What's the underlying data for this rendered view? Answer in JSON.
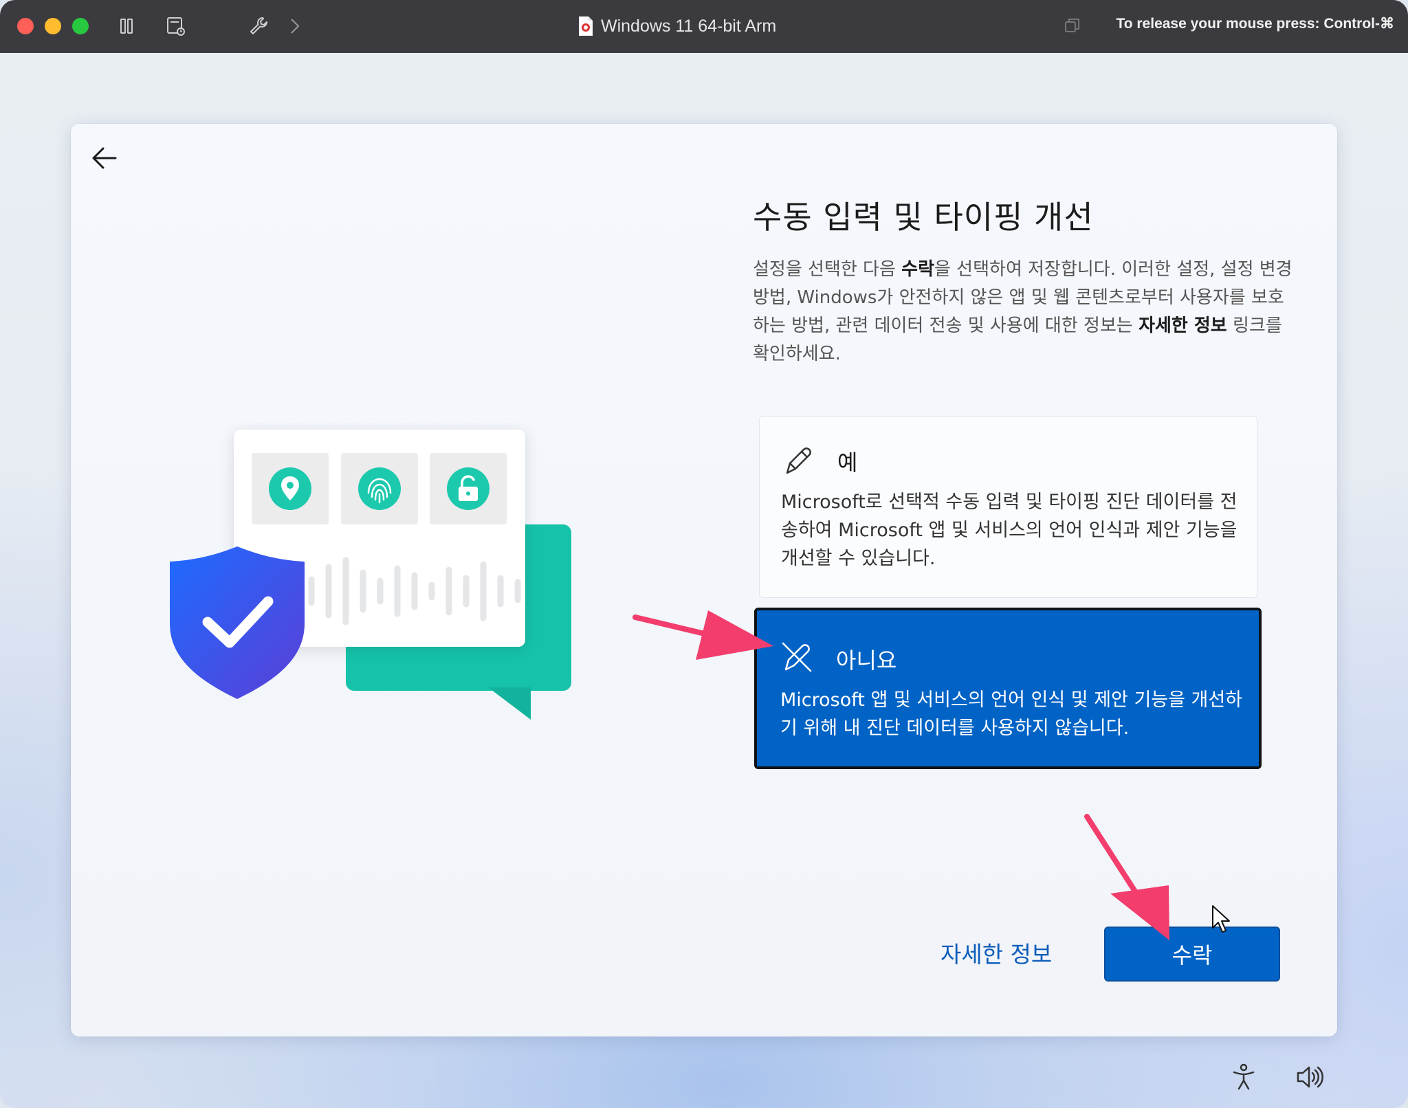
{
  "window": {
    "title": "Windows 11 64-bit Arm",
    "release_hint": "To release your mouse press: Control-⌘"
  },
  "toolbar_icons": [
    "sidebar-toggle-icon",
    "snapshot-icon",
    "wrench-icon",
    "chevron-right-icon",
    "window-copy-icon"
  ],
  "oobe": {
    "title": "수동 입력 및 타이핑 개선",
    "description": {
      "part1": "설정을 선택한 다음 ",
      "bold1": "수락",
      "part2": "을 선택하여 저장합니다. 이러한 설정, 설정 변경 방법, Windows가 안전하지 않은 앱 및 웹 콘텐츠로부터 사용자를 보호하는 방법, 관련 데이터 전송 및 사용에 대한 정보는 ",
      "bold2": "자세한 정보",
      "part3": " 링크를 확인하세요."
    },
    "options": [
      {
        "label": "예",
        "description": "Microsoft로 선택적 수동 입력 및 타이핑 진단 데이터를 전송하여 Microsoft 앱 및 서비스의 언어 인식과 제안 기능을 개선할 수 있습니다.",
        "icon": "pen-icon",
        "selected": false
      },
      {
        "label": "아니요",
        "description": "Microsoft 앱 및 서비스의 언어 인식 및 제안 기능을 개선하기 위해 내 진단 데이터를 사용하지 않습니다.",
        "icon": "pen-off-icon",
        "selected": true
      }
    ],
    "learn_more": "자세한 정보",
    "accept": "수락"
  },
  "colors": {
    "accent": "#0063c5",
    "annotation_arrow": "#f23d6d",
    "illustration_teal": "#1fc9b0",
    "shield_blue": "#2a5fe0"
  }
}
